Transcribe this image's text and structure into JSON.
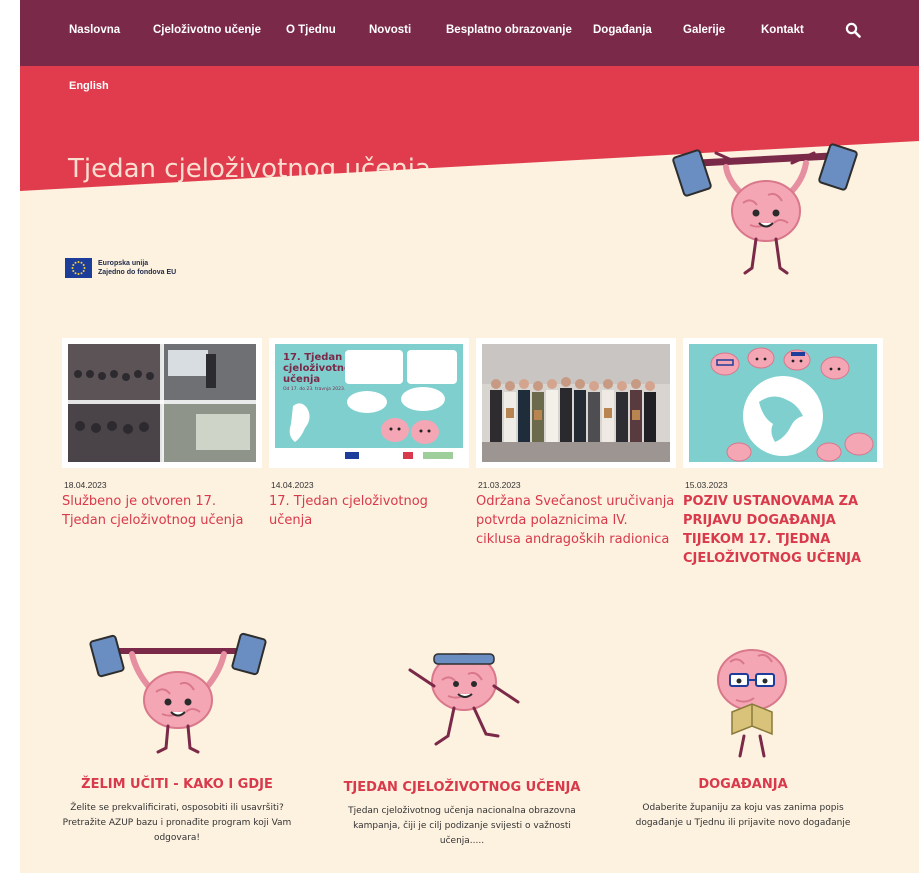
{
  "nav": {
    "items": [
      "Naslovna",
      "Cjeloživotno učenje",
      "O Tjednu",
      "Novosti",
      "Besplatno obrazovanje",
      "Događanja",
      "Galerije",
      "Kontakt"
    ]
  },
  "language_link": "English",
  "hero": {
    "title": "Tjedan cjeloživotnog učenja"
  },
  "eu_logo": {
    "line1": "Europska unija",
    "line2": "Zajedno do fondova EU"
  },
  "news": [
    {
      "date": "18.04.2023",
      "title": "Službeno je otvoren 17. Tjedan cjeloživotnog učenja"
    },
    {
      "date": "14.04.2023",
      "title": "17. Tjedan cjeloživotnog učenja",
      "poster": {
        "heading_line1": "17. Tjedan",
        "heading_line2": "cjeloživotnog",
        "heading_line3": "učenja",
        "dates": "Od 17. do 23. travnja 2023."
      }
    },
    {
      "date": "21.03.2023",
      "title": "Održana Svečanost uručivanja potvrda polaznicima IV. ciklusa andragoških radionica"
    },
    {
      "date": "15.03.2023",
      "title": "POZIV USTANOVAMA ZA PRIJAVU DOGAĐANJA TIJEKOM 17. TJEDNA CJELOŽIVOTNOG UČENJA"
    }
  ],
  "features": [
    {
      "title": "ŽELIM UČITI - KAKO I GDJE",
      "desc": "Želite se prekvalificirati, osposobiti ili usavršiti? Pretražite AZUP bazu i pronađite program koji Vam odgovara!"
    },
    {
      "title": "TJEDAN CJELOŽIVOTNOG UČENJA",
      "desc": "Tjedan cjeloživotnog učenja nacionalna obrazovna kampanja, čiji je cilj podizanje svijesti o važnosti učenja....."
    },
    {
      "title": "DOGAĐANJA",
      "desc": "Odaberite županiju za koju vas zanima popis događanje u Tjednu ili prijavite novo događanje"
    }
  ],
  "colors": {
    "nav_bg": "#7b2948",
    "hero_red": "#e03c4e",
    "page_bg": "#fdf1df",
    "accent": "#d8394b",
    "brain_pink": "#f4a6b4"
  }
}
